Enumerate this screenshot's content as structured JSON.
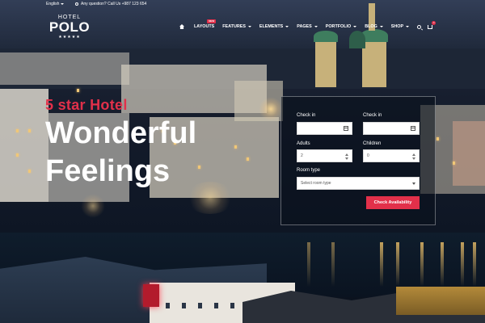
{
  "topbar": {
    "language": "English",
    "contact_text": "Any question? Call Us +987 123 654"
  },
  "logo": {
    "small": "HOTEL",
    "big": "POLO",
    "stars": "★★★★★"
  },
  "nav": {
    "home_icon": "home-icon",
    "items": [
      {
        "label": "LAYOUTS",
        "badge": "NEW",
        "has_dropdown": false
      },
      {
        "label": "FEATURES",
        "has_dropdown": true
      },
      {
        "label": "ELEMENTS",
        "has_dropdown": true
      },
      {
        "label": "PAGES",
        "has_dropdown": true
      },
      {
        "label": "PORTFOLIO",
        "has_dropdown": true
      },
      {
        "label": "BLOG",
        "has_dropdown": true
      },
      {
        "label": "SHOP",
        "has_dropdown": true
      }
    ],
    "search_icon": "search-icon",
    "cart_icon": "cart-icon",
    "cart_count": "0"
  },
  "hero": {
    "kicker": "5 star Hotel",
    "title_line1": "Wonderful",
    "title_line2": "Feelings"
  },
  "booking": {
    "checkin_label": "Check in",
    "checkout_label": "Check in",
    "checkin_value": "",
    "checkout_value": "",
    "adults_label": "Adults",
    "adults_value": "2",
    "children_label": "Children",
    "children_value": "0",
    "roomtype_label": "Room type",
    "roomtype_value": "Select room type",
    "cta_label": "Check Availability"
  },
  "colors": {
    "accent": "#e2304a",
    "text_light": "#ffffff",
    "overlay": "#0a101c"
  }
}
